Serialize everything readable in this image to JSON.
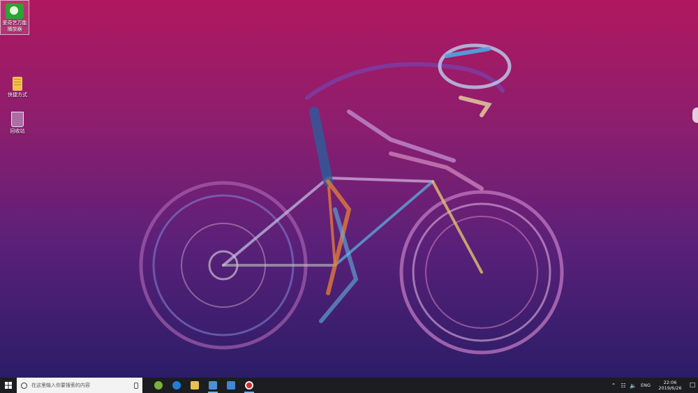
{
  "desktop": {
    "icons": [
      {
        "label": "爱奇艺万能播放器"
      },
      {
        "label": "快捷方式"
      },
      {
        "label": "回收站"
      }
    ]
  },
  "taskbar": {
    "search_placeholder": "在这里输入你要搜索的内容",
    "apps": [
      {
        "name": "360-browser-icon",
        "color": "#7bb13a"
      },
      {
        "name": "edge-icon",
        "color": "#1f7fd6"
      },
      {
        "name": "file-explorer-icon",
        "color": "#e9c04b"
      },
      {
        "name": "control-panel-icon",
        "color": "#4d8fd9"
      },
      {
        "name": "store-icon",
        "color": "#3f87d9"
      },
      {
        "name": "screen-recorder-icon",
        "color": "#d32b2b"
      }
    ],
    "tray": {
      "language": "ENG",
      "time": "22:06",
      "date": "2019/6/26"
    }
  },
  "colors": {
    "bg_top": "#b0185f",
    "bg_bottom": "#2b1d67",
    "taskbar": "#1c1d20"
  }
}
